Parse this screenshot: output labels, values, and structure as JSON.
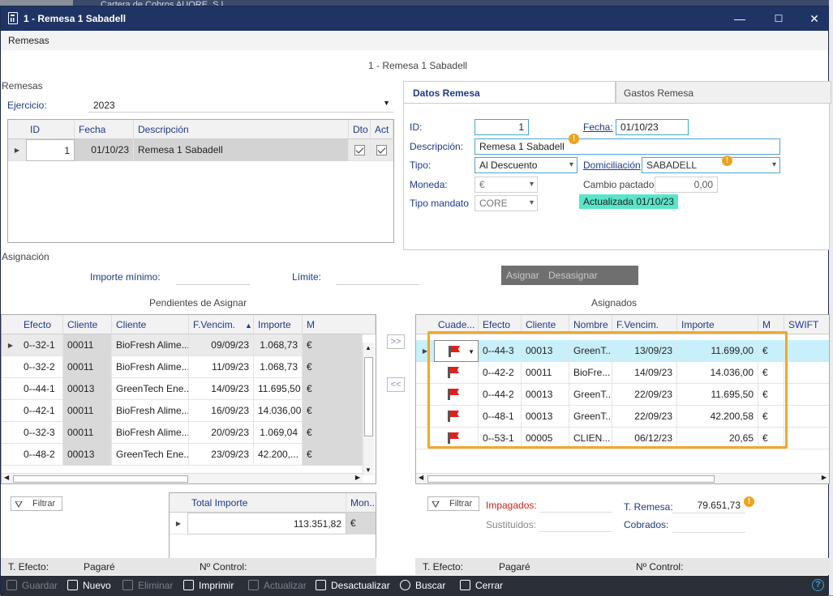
{
  "bg_window_title": "Cartera de Cobros AUORE, S.L.",
  "window": {
    "title": "1 - Remesa 1 Sabadell",
    "min": "—",
    "max": "☐",
    "close": "✕"
  },
  "menu": {
    "remesas": "Remesas"
  },
  "header_title": "1 - Remesa 1 Sabadell",
  "remesas_section": {
    "label": "Remesas",
    "ejercicio_label": "Ejercicio:",
    "ejercicio_value": "2023",
    "columns": [
      "ID",
      "Fecha",
      "Descripción",
      "Dto",
      "Act"
    ],
    "rows": [
      {
        "id": "1",
        "fecha": "01/10/23",
        "descripcion": "Remesa 1 Sabadell"
      }
    ]
  },
  "tabs": {
    "datos": "Datos Remesa",
    "gastos": "Gastos Remesa"
  },
  "datos": {
    "id_label": "ID:",
    "id_value": "1",
    "fecha_label": "Fecha:",
    "fecha_value": "01/10/23",
    "descripcion_label": "Descripción:",
    "descripcion_value": "Remesa 1 Sabadell",
    "tipo_label": "Tipo:",
    "tipo_value": "Al Descuento",
    "domiciliacion_label": "Domiciliación",
    "domiciliacion_value": "SABADELL",
    "moneda_label": "Moneda:",
    "moneda_value": "€",
    "cambio_label": "Cambio pactado",
    "cambio_value": "0,00",
    "mandato_label": "Tipo mandato",
    "mandato_value": "CORE",
    "status": "Actualizada 01/10/23"
  },
  "asignacion": {
    "label": "Asignación",
    "importe_minimo_label": "Importe mínimo:",
    "limite_label": "Límite:",
    "asignar": "Asignar",
    "desasignar": "Desasignar",
    "pendientes_title": "Pendientes de Asignar",
    "asignados_title": "Asignados",
    "move_right": ">>",
    "move_left": "<<"
  },
  "pendientes": {
    "columns": [
      "Efecto",
      "Cliente",
      "Cliente",
      "F.Vencim.",
      "Importe",
      "M"
    ],
    "rows": [
      {
        "efecto": "0--32-1",
        "cliente": "00011",
        "nombre": "BioFresh Alime...",
        "fecha": "09/09/23",
        "importe": "1.068,73",
        "m": "€"
      },
      {
        "efecto": "0--32-2",
        "cliente": "00011",
        "nombre": "BioFresh Alime...",
        "fecha": "11/09/23",
        "importe": "1.068,73",
        "m": "€"
      },
      {
        "efecto": "0--44-1",
        "cliente": "00013",
        "nombre": "GreenTech Ene...",
        "fecha": "14/09/23",
        "importe": "11.695,50",
        "m": "€"
      },
      {
        "efecto": "0--42-1",
        "cliente": "00011",
        "nombre": "BioFresh Alime...",
        "fecha": "16/09/23",
        "importe": "14.036,00",
        "m": "€"
      },
      {
        "efecto": "0--32-3",
        "cliente": "00011",
        "nombre": "BioFresh Alime...",
        "fecha": "20/09/23",
        "importe": "1.069,04",
        "m": "€"
      },
      {
        "efecto": "0--48-2",
        "cliente": "00013",
        "nombre": "GreenTech Ene...",
        "fecha": "23/09/23",
        "importe": "42.200,...",
        "m": "€"
      }
    ]
  },
  "asignados": {
    "columns": [
      "Cuade...",
      "Efecto",
      "Cliente",
      "Nombre",
      "F.Vencim.",
      "Importe",
      "M",
      "SWIFT"
    ],
    "rows": [
      {
        "efecto": "0--44-3",
        "cliente": "00013",
        "nombre": "GreenT...",
        "fecha": "13/09/23",
        "importe": "11.699,00",
        "m": "€"
      },
      {
        "efecto": "0--42-2",
        "cliente": "00011",
        "nombre": "BioFre...",
        "fecha": "14/09/23",
        "importe": "14.036,00",
        "m": "€"
      },
      {
        "efecto": "0--44-2",
        "cliente": "00013",
        "nombre": "GreenT...",
        "fecha": "22/09/23",
        "importe": "11.695,50",
        "m": "€"
      },
      {
        "efecto": "0--48-1",
        "cliente": "00013",
        "nombre": "GreenT...",
        "fecha": "22/09/23",
        "importe": "42.200,58",
        "m": "€"
      },
      {
        "efecto": "0--53-1",
        "cliente": "00005",
        "nombre": "CLIEN...",
        "fecha": "06/12/23",
        "importe": "20,65",
        "m": "€"
      }
    ]
  },
  "totals": {
    "filtrar": "Filtrar",
    "total_importe_label": "Total Importe",
    "moneda_col": "Mon...",
    "total_importe_value": "113.351,82",
    "moneda_value": "€",
    "impagados_label": "Impagados:",
    "sustituidos_label": "Sustituidos:",
    "t_remesa_label": "T. Remesa:",
    "t_remesa_value": "79.651,73",
    "cobrados_label": "Cobrados:"
  },
  "footer": {
    "t_efecto_label": "T. Efecto:",
    "t_efecto_value": "Pagaré",
    "n_control_label": "Nº Control:"
  },
  "toolbar": {
    "guardar": "Guardar",
    "nuevo": "Nuevo",
    "eliminar": "Eliminar",
    "imprimir": "Imprimir",
    "actualizar": "Actualizar",
    "desactualizar": "Desactualizar",
    "buscar": "Buscar",
    "cerrar": "Cerrar",
    "help": "?"
  }
}
